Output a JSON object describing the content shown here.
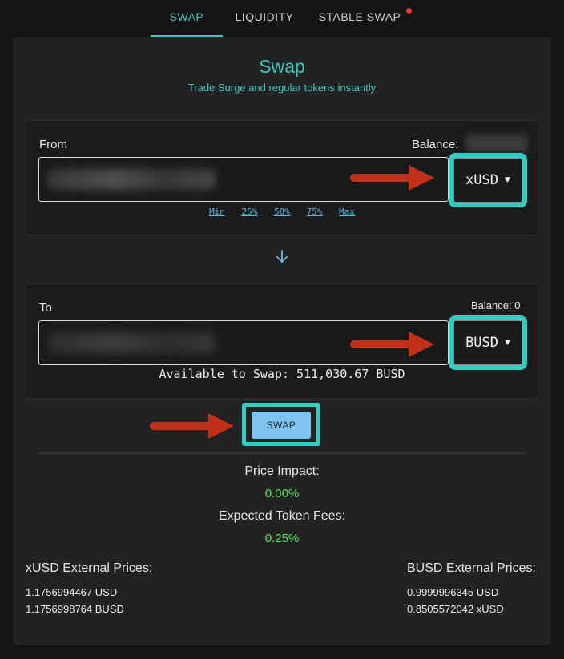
{
  "tabs": [
    {
      "label": "SWAP"
    },
    {
      "label": "LIQUIDITY"
    },
    {
      "label": "STABLE SWAP"
    }
  ],
  "header": {
    "title": "Swap",
    "subtitle": "Trade Surge and regular tokens instantly"
  },
  "from": {
    "label": "From",
    "balance_label": "Balance:",
    "token": "xUSD",
    "percent_options": [
      "Min",
      "25%",
      "50%",
      "75%",
      "Max"
    ]
  },
  "to": {
    "label": "To",
    "balance_label": "Balance: 0",
    "token": "BUSD",
    "available": "Available to Swap: 511,030.67 BUSD"
  },
  "swap_button": "SWAP",
  "stats": {
    "price_impact_label": "Price Impact:",
    "price_impact_value": "0.00%",
    "fees_label": "Expected Token Fees:",
    "fees_value": "0.25%"
  },
  "external_prices": {
    "left": {
      "title": "xUSD External Prices:",
      "lines": [
        "1.1756994467 USD",
        "1.1756998764 BUSD"
      ]
    },
    "right": {
      "title": "BUSD External Prices:",
      "lines": [
        "0.9999996345 USD",
        "0.8505572042 xUSD"
      ]
    }
  },
  "colors": {
    "accent": "#3fc7bf",
    "highlight_ring": "#31cdc3",
    "arrow": "#c0301a",
    "positive": "#5ce05c",
    "notification_dot": "#e53935"
  }
}
